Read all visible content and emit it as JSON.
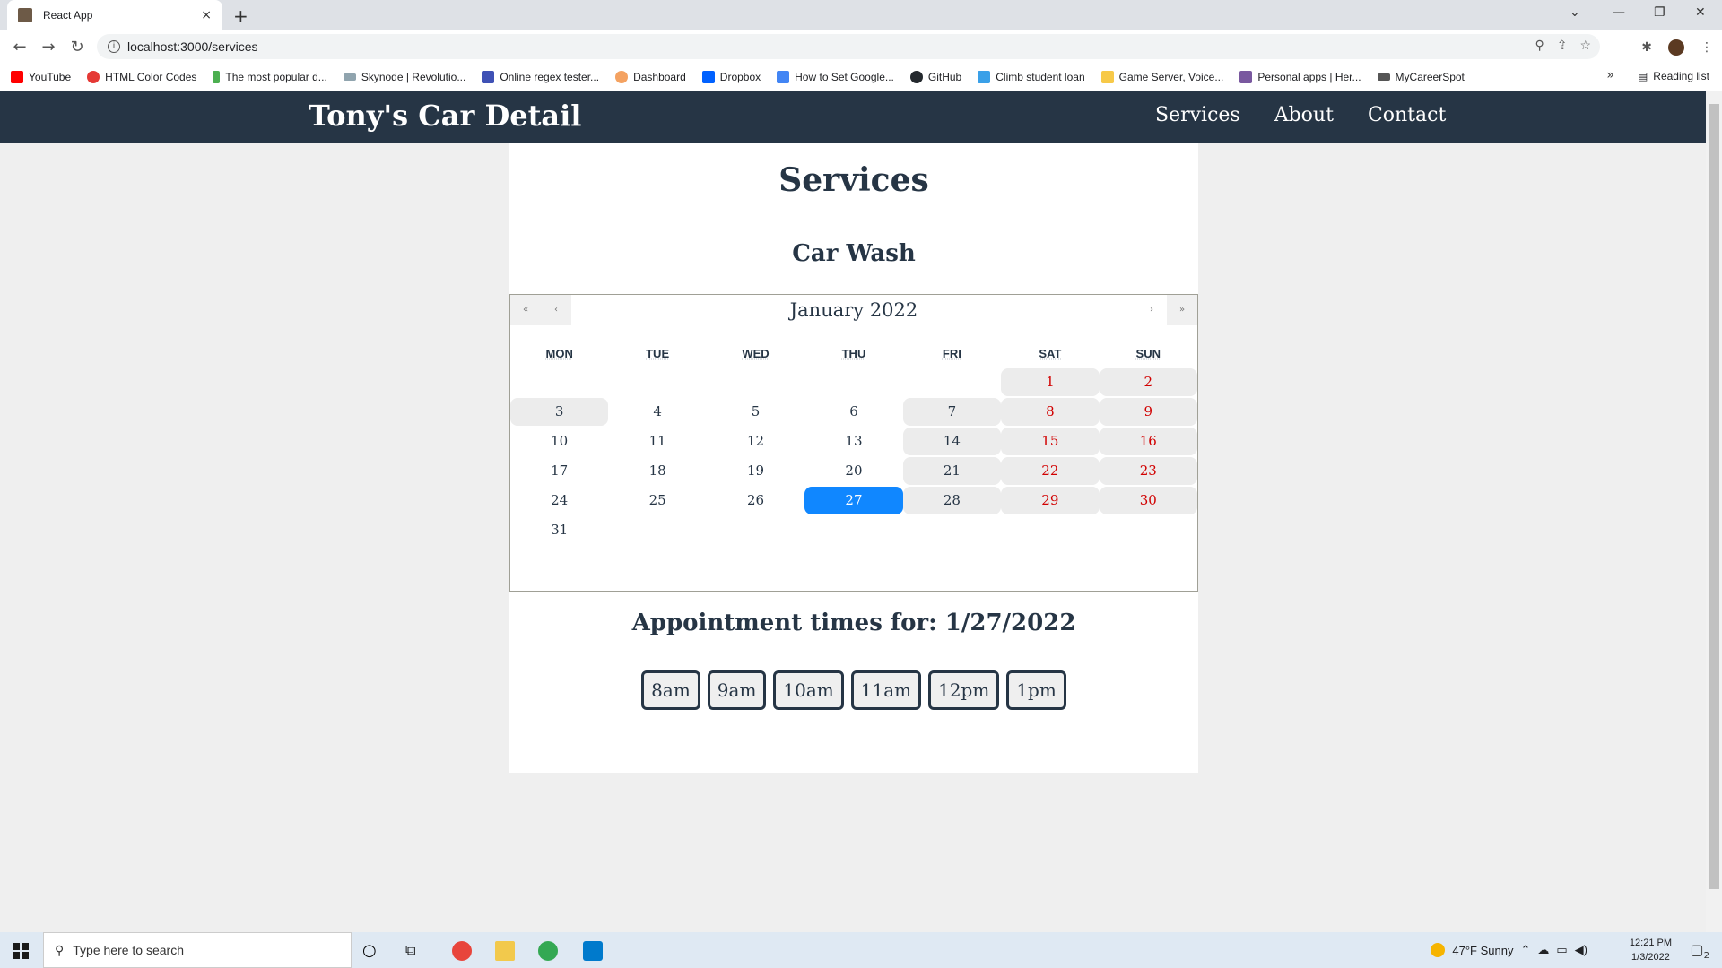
{
  "browser": {
    "tab_title": "React App",
    "tab_close": "×",
    "new_tab": "+",
    "url": "localhost:3000/services",
    "bookmarks": [
      {
        "label": "YouTube",
        "color": "#ff0000"
      },
      {
        "label": "HTML Color Codes",
        "color": "#e53935"
      },
      {
        "label": "The most popular d...",
        "color": "#4caf50"
      },
      {
        "label": "Skynode | Revolutio...",
        "color": "#90a4ae"
      },
      {
        "label": "Online regex tester...",
        "color": "#3f51b5"
      },
      {
        "label": "Dashboard",
        "color": "#f4a261"
      },
      {
        "label": "Dropbox",
        "color": "#0061ff"
      },
      {
        "label": "How to Set Google...",
        "color": "#4285f4"
      },
      {
        "label": "GitHub",
        "color": "#24292e"
      },
      {
        "label": "Climb student loan",
        "color": "#3aa0e8"
      },
      {
        "label": "Game Server, Voice...",
        "color": "#f7c948"
      },
      {
        "label": "Personal apps | Her...",
        "color": "#79589f"
      },
      {
        "label": "MyCareerSpot",
        "color": "#555555"
      }
    ],
    "bookmarks_more": "»",
    "reading_list": "Reading list"
  },
  "app": {
    "brand": "Tony's Car Detail",
    "nav": [
      "Services",
      "About",
      "Contact"
    ],
    "page_title": "Services",
    "service_name": "Car Wash",
    "calendar": {
      "label": "January 2022",
      "prev2": "«",
      "prev": "‹",
      "next": "›",
      "next2": "»",
      "weekdays": [
        "MON",
        "TUE",
        "WED",
        "THU",
        "FRI",
        "SAT",
        "SUN"
      ],
      "selected": "27"
    },
    "appointment_heading": "Appointment times for: 1/27/2022",
    "times": [
      "8am",
      "9am",
      "10am",
      "11am",
      "12pm",
      "1pm"
    ]
  },
  "taskbar": {
    "search_placeholder": "Type here to search",
    "weather": "47°F  Sunny",
    "time": "12:21 PM",
    "date": "1/3/2022",
    "notifications": "2"
  }
}
